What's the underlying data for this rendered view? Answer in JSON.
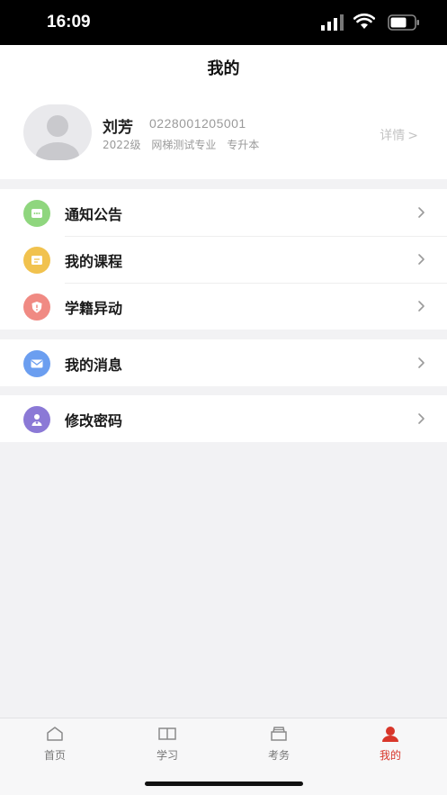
{
  "status": {
    "time": "16:09"
  },
  "nav": {
    "title": "我的"
  },
  "profile": {
    "name": "刘芳",
    "student_id": "0228001205001",
    "grade": "2022级",
    "major": "网梯测试专业",
    "level": "专升本",
    "details_label": "详情"
  },
  "menu_groups": [
    [
      {
        "label": "通知公告",
        "icon": "notice-icon",
        "color": "#8fd67e"
      },
      {
        "label": "我的课程",
        "icon": "course-icon",
        "color": "#f1c24e"
      },
      {
        "label": "学籍异动",
        "icon": "status-change-icon",
        "color": "#f08a83"
      }
    ],
    [
      {
        "label": "我的消息",
        "icon": "message-icon",
        "color": "#6b9ef0"
      }
    ],
    [
      {
        "label": "修改密码",
        "icon": "password-icon",
        "color": "#8b79d6"
      }
    ]
  ],
  "tabbar": {
    "items": [
      {
        "label": "首页",
        "icon": "home-icon",
        "active": false
      },
      {
        "label": "学习",
        "icon": "book-icon",
        "active": false
      },
      {
        "label": "考务",
        "icon": "exam-icon",
        "active": false
      },
      {
        "label": "我的",
        "icon": "profile-icon",
        "active": true
      }
    ],
    "active_color": "#d8362a"
  }
}
